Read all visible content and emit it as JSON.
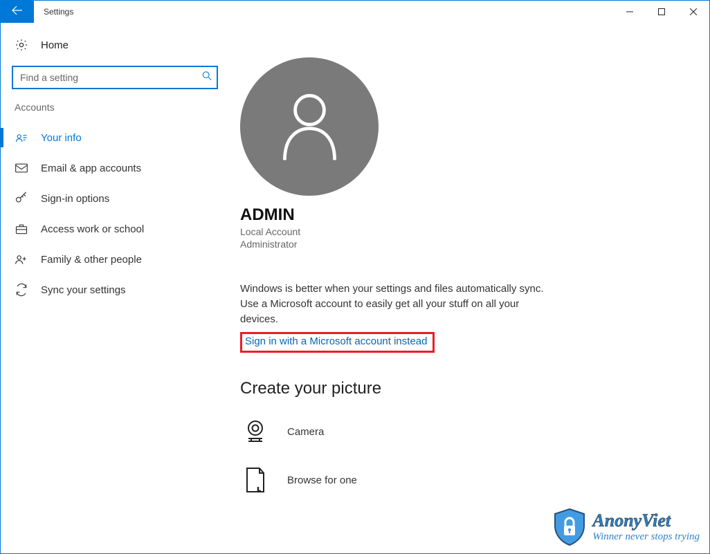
{
  "window": {
    "title": "Settings"
  },
  "sidebar": {
    "home": "Home",
    "search_placeholder": "Find a setting",
    "section": "Accounts",
    "items": [
      {
        "label": "Your info",
        "active": true
      },
      {
        "label": "Email & app accounts",
        "active": false
      },
      {
        "label": "Sign-in options",
        "active": false
      },
      {
        "label": "Access work or school",
        "active": false
      },
      {
        "label": "Family & other people",
        "active": false
      },
      {
        "label": "Sync your settings",
        "active": false
      }
    ]
  },
  "main": {
    "account_name": "ADMIN",
    "account_type": "Local Account",
    "account_role": "Administrator",
    "sync_description": "Windows is better when your settings and files automatically sync. Use a Microsoft account to easily get all your stuff on all your devices.",
    "ms_link": "Sign in with a Microsoft account instead",
    "create_picture_title": "Create your picture",
    "pic_options": {
      "camera": "Camera",
      "browse": "Browse for one"
    }
  },
  "watermark": {
    "name": "AnonyViet",
    "tagline": "Winner never stops trying"
  },
  "colors": {
    "accent": "#0078d7",
    "highlight_border": "#ed1c24",
    "link": "#0067b8",
    "avatar_bg": "#7a7a7a"
  }
}
